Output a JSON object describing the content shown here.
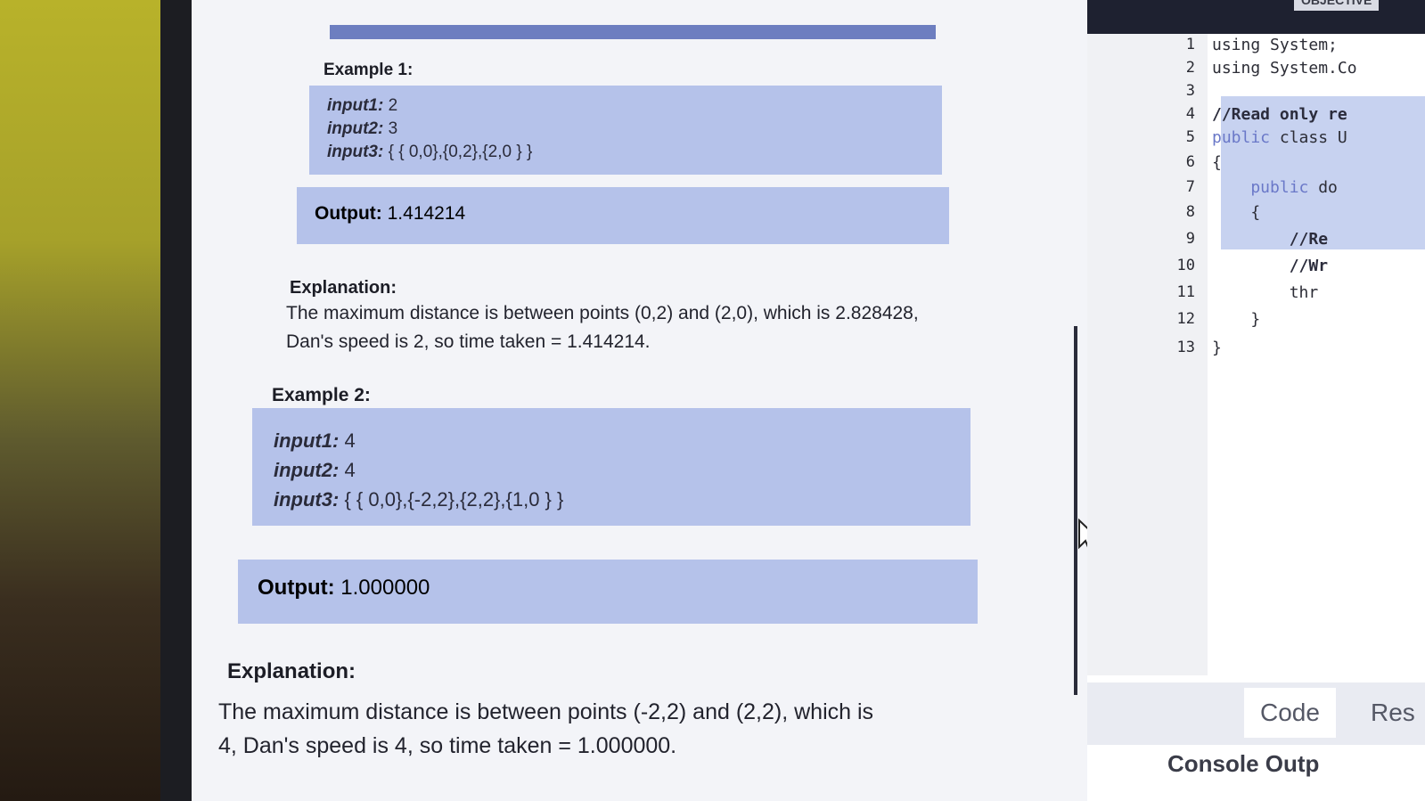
{
  "problem": {
    "example1": {
      "label": "Example 1:",
      "input1_label": "input1:",
      "input1_value": " 2",
      "input2_label": "input2:",
      "input2_value": " 3",
      "input3_label": "input3:",
      "input3_value": " { { 0,0},{0,2},{2,0 } }",
      "output_label": "Output:",
      "output_value": " 1.414214",
      "explanation_label": "Explanation:",
      "explanation_line1": "The maximum distance is between points (0,2) and (2,0), which is 2.828428,",
      "explanation_line2": "Dan's speed is 2, so time taken = 1.414214."
    },
    "example2": {
      "label": "Example 2:",
      "input1_label": "input1:",
      "input1_value": " 4",
      "input2_label": "input2:",
      "input2_value": " 4",
      "input3_label": "input3:",
      "input3_value": " { { 0,0},{-2,2},{2,2},{1,0 } }",
      "output_label": "Output:",
      "output_value": " 1.000000",
      "explanation_label": "Explanation:",
      "explanation_line1": "The maximum distance is between points (-2,2) and (2,2), which is",
      "explanation_line2": "4, Dan's speed is 4, so time taken = 1.000000."
    }
  },
  "editor": {
    "top_tag": "OBJECTIVE",
    "line_numbers": [
      "1",
      "2",
      "3",
      "4",
      "5",
      "6",
      "7",
      "8",
      "9",
      "10",
      "11",
      "12",
      "13"
    ],
    "lines": [
      "using System;",
      "using System.Co",
      "",
      "//Read only re",
      "public class U",
      "{",
      "    public do",
      "    {",
      "        //Re",
      "        //Wr",
      "        thr",
      "    }",
      "}"
    ],
    "tabs": {
      "code": "Code",
      "result": "Res"
    },
    "console_label": "Console Outp"
  }
}
